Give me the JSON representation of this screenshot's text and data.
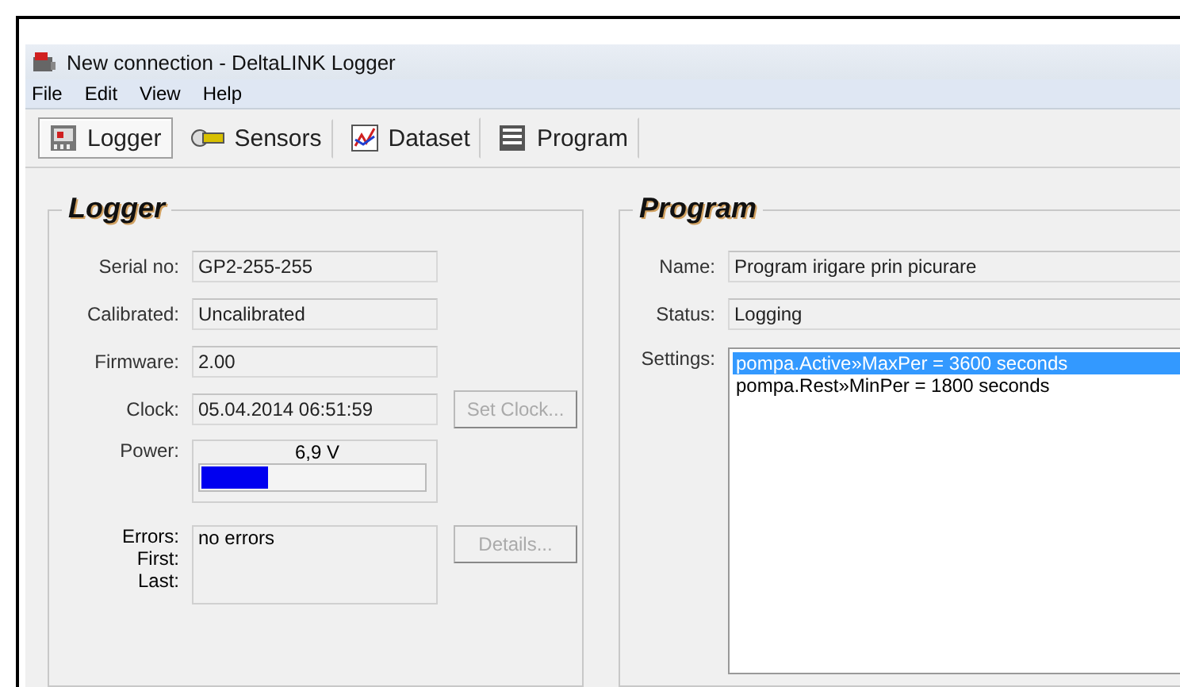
{
  "window": {
    "title": "New connection - DeltaLINK Logger"
  },
  "menu": [
    "File",
    "Edit",
    "View",
    "Help"
  ],
  "tabs": [
    {
      "label": "Logger",
      "selected": true,
      "kind": "logger"
    },
    {
      "label": "Sensors",
      "selected": false,
      "kind": "sensors"
    },
    {
      "label": "Dataset",
      "selected": false,
      "kind": "dataset"
    },
    {
      "label": "Program",
      "selected": false,
      "kind": "program"
    }
  ],
  "logger": {
    "title": "Logger",
    "fields": [
      {
        "label": "Serial no:",
        "value": "GP2-255-255"
      },
      {
        "label": "Calibrated:",
        "value": "Uncalibrated"
      },
      {
        "label": "Firmware:",
        "value": "2.00"
      },
      {
        "label": "Clock:",
        "value": "05.04.2014 06:51:59",
        "button": "Set Clock...",
        "button_disabled": true
      }
    ],
    "power": {
      "label": "Power:",
      "reading": "6,9 V",
      "level": 0.3
    },
    "errors": {
      "labels": [
        "Errors:",
        "First:",
        "Last:"
      ],
      "value": "no errors",
      "button": "Details...",
      "button_disabled": true
    }
  },
  "program": {
    "title": "Program",
    "fields": [
      {
        "label": "Name:",
        "value": "Program irigare prin picurare"
      },
      {
        "label": "Status:",
        "value": "Logging"
      }
    ],
    "settings": {
      "label": "Settings:",
      "items": [
        {
          "text": "pompa.Active»MaxPer = 3600 seconds",
          "selected": true
        },
        {
          "text": "pompa.Rest»MinPer = 1800 seconds",
          "selected": false
        }
      ]
    }
  }
}
